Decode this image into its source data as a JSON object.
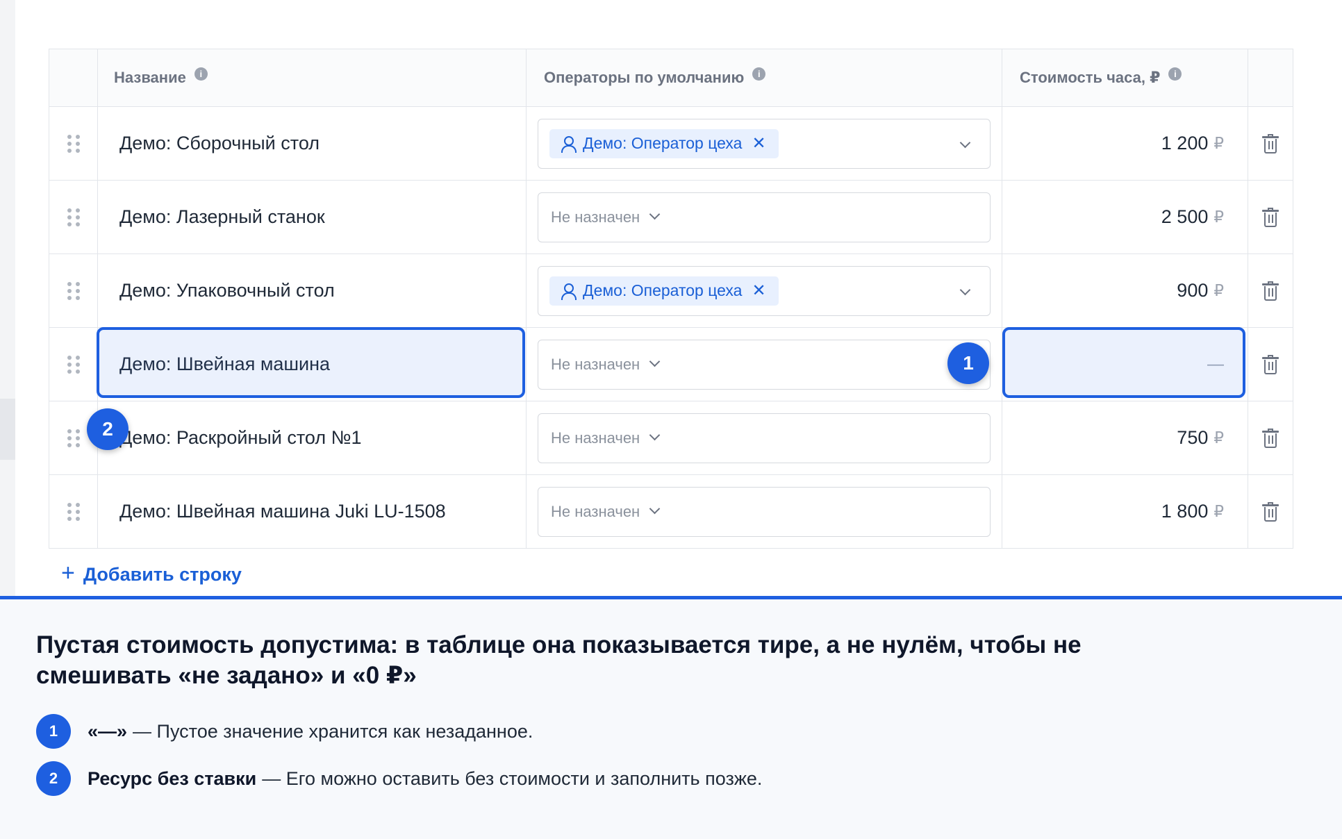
{
  "table": {
    "headers": {
      "name": "Название",
      "operators": "Операторы по умолчанию",
      "cost": "Стоимость часа, ₽"
    },
    "info_icon_glyph": "i",
    "currency": "₽",
    "remove_glyph": "✕",
    "rows": [
      {
        "name": "Демо: Сборочный стол",
        "operator": "Демо: Оператор цеха",
        "cost": "1 200",
        "placeholder": ""
      },
      {
        "name": "Демо: Лазерный станок",
        "operator": "",
        "cost": "2 500",
        "placeholder": "Не назначен"
      },
      {
        "name": "Демо: Упаковочный стол",
        "operator": "Демо: Оператор цеха",
        "cost": "900",
        "placeholder": ""
      },
      {
        "name": "Демо: Швейная машина",
        "operator": "",
        "cost": "—",
        "placeholder": "Не назначен"
      },
      {
        "name": "Демо: Раскройный стол №1",
        "operator": "",
        "cost": "750",
        "placeholder": "Не назначен"
      },
      {
        "name": "Демо: Швейная машина Juki LU-1508",
        "operator": "",
        "cost": "1 800",
        "placeholder": "Не назначен"
      }
    ]
  },
  "add_row": {
    "plus": "+",
    "label": "Добавить строку"
  },
  "badges": {
    "one": "1",
    "two": "2"
  },
  "panel": {
    "title": "Пустая стоимость допустима: в таблице она показывается тире, а не нулём, чтобы не смешивать «не задано» и «0 ₽»",
    "notes": [
      {
        "num": "1",
        "term": "«—»",
        "text": "— Пустое значение хранится как незаданное."
      },
      {
        "num": "2",
        "term": "Ресурс без ставки",
        "text": "— Его можно оставить без стоимости и заполнить позже."
      }
    ]
  },
  "colors": {
    "accent": "#1e5fe0",
    "chip_bg": "#e8f0fe",
    "chip_text": "#1a5fd6"
  }
}
